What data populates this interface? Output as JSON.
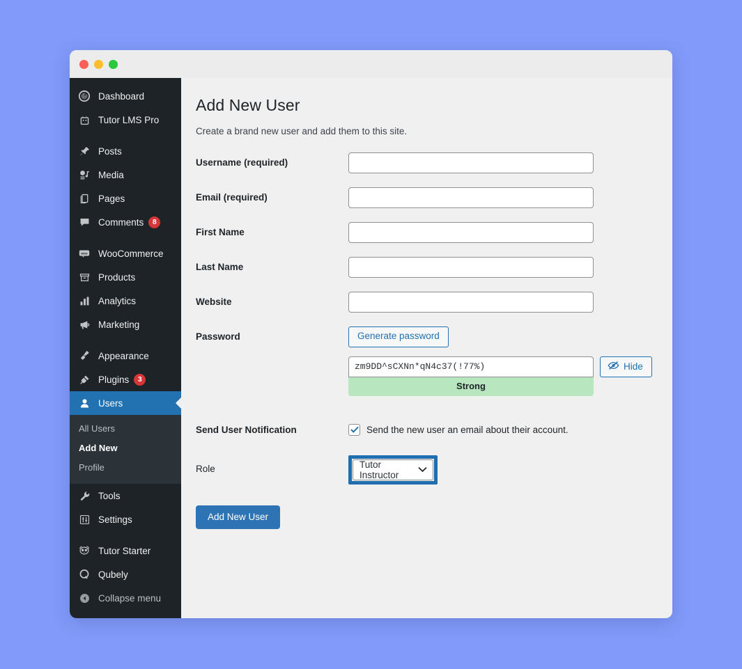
{
  "window": {
    "traffic_lights": [
      "close",
      "minimize",
      "zoom"
    ]
  },
  "sidebar": {
    "items": [
      {
        "label": "Dashboard",
        "icon": "dashboard-icon",
        "badge": null,
        "active": false
      },
      {
        "label": "Tutor LMS Pro",
        "icon": "tutor-lms-icon",
        "badge": null,
        "active": false
      },
      {
        "label": "Posts",
        "icon": "pin-icon",
        "badge": null,
        "active": false
      },
      {
        "label": "Media",
        "icon": "media-icon",
        "badge": null,
        "active": false
      },
      {
        "label": "Pages",
        "icon": "pages-icon",
        "badge": null,
        "active": false
      },
      {
        "label": "Comments",
        "icon": "comment-icon",
        "badge": "8",
        "active": false
      },
      {
        "label": "WooCommerce",
        "icon": "woocommerce-icon",
        "badge": null,
        "active": false
      },
      {
        "label": "Products",
        "icon": "products-icon",
        "badge": null,
        "active": false
      },
      {
        "label": "Analytics",
        "icon": "analytics-icon",
        "badge": null,
        "active": false
      },
      {
        "label": "Marketing",
        "icon": "megaphone-icon",
        "badge": null,
        "active": false
      },
      {
        "label": "Appearance",
        "icon": "paintbrush-icon",
        "badge": null,
        "active": false
      },
      {
        "label": "Plugins",
        "icon": "plug-icon",
        "badge": "3",
        "active": false
      },
      {
        "label": "Users",
        "icon": "user-icon",
        "badge": null,
        "active": true
      },
      {
        "label": "Tools",
        "icon": "wrench-icon",
        "badge": null,
        "active": false
      },
      {
        "label": "Settings",
        "icon": "sliders-icon",
        "badge": null,
        "active": false
      },
      {
        "label": "Tutor Starter",
        "icon": "owl-icon",
        "badge": null,
        "active": false
      },
      {
        "label": "Qubely",
        "icon": "qubely-icon",
        "badge": null,
        "active": false
      },
      {
        "label": "Collapse menu",
        "icon": "collapse-arrow-icon",
        "badge": null,
        "active": false
      }
    ],
    "submenu": {
      "items": [
        {
          "label": "All Users",
          "current": false
        },
        {
          "label": "Add New",
          "current": true
        },
        {
          "label": "Profile",
          "current": false
        }
      ]
    }
  },
  "main": {
    "title": "Add New User",
    "description": "Create a brand new user and add them to this site.",
    "fields": {
      "username": {
        "label": "Username",
        "required_note": "(required)",
        "value": "",
        "placeholder": ""
      },
      "email": {
        "label": "Email",
        "required_note": "(required)",
        "value": "",
        "placeholder": ""
      },
      "first_name": {
        "label": "First Name",
        "value": "",
        "placeholder": ""
      },
      "last_name": {
        "label": "Last Name",
        "value": "",
        "placeholder": ""
      },
      "website": {
        "label": "Website",
        "value": "",
        "placeholder": ""
      }
    },
    "password": {
      "label": "Password",
      "generate_label": "Generate password",
      "value": "zm9DD^sCXNn*qN4c37(!77%)",
      "strength": "Strong",
      "hide_label": "Hide"
    },
    "notification": {
      "label": "Send User Notification",
      "checkbox_label": "Send the new user an email about their account.",
      "checked": true
    },
    "role": {
      "label": "Role",
      "selected": "Tutor Instructor",
      "highlighted": true
    },
    "submit": {
      "label": "Add New User"
    }
  },
  "colors": {
    "page_background": "#829bfa",
    "sidebar": "#1d2327",
    "submenu": "#2c3338",
    "accent_blue": "#2271b1",
    "badge_red": "#d63638",
    "strength_green": "#b8e6bf",
    "highlight_ring": "#1e6eb0",
    "content_background": "#f0f0f1"
  }
}
